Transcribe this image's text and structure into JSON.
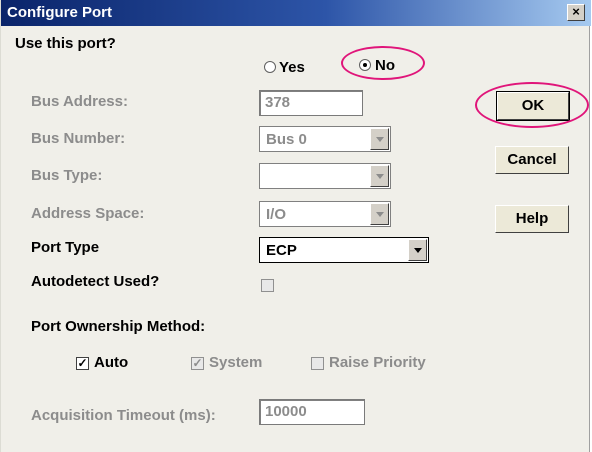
{
  "window": {
    "title": "Configure Port",
    "close_glyph": "×"
  },
  "use_port": {
    "label": "Use this port?",
    "yes_label": "Yes",
    "no_label": "No",
    "selected": "No"
  },
  "bus_address": {
    "label": "Bus Address:",
    "value": "378"
  },
  "bus_number": {
    "label": "Bus Number:",
    "value": "Bus 0"
  },
  "bus_type": {
    "label": "Bus Type:",
    "value": ""
  },
  "address_space": {
    "label": "Address Space:",
    "value": "I/O"
  },
  "port_type": {
    "label": "Port Type",
    "value": "ECP"
  },
  "autodetect": {
    "label": "Autodetect Used?",
    "checked": false
  },
  "ownership": {
    "label": "Port Ownership Method:",
    "auto_label": "Auto",
    "auto_checked": true,
    "system_label": "System",
    "system_checked": true,
    "raise_label": "Raise Priority",
    "raise_checked": false
  },
  "timeout": {
    "label": "Acquisition Timeout (ms):",
    "value": "10000"
  },
  "buttons": {
    "ok": "OK",
    "cancel": "Cancel",
    "help": "Help"
  },
  "highlight_color": "#e0157a"
}
